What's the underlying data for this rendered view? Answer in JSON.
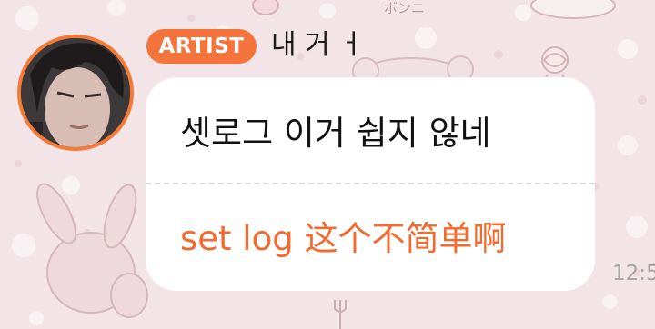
{
  "sender": {
    "badge_label": "ARTIST",
    "name": "내 거 ㅓ"
  },
  "message": {
    "original": "셋로그 이거 쉽지 않네",
    "translation": "set log 这个不简单啊",
    "time": "12:5"
  },
  "background": {
    "sticker_text": "ボンニ"
  },
  "colors": {
    "accent": "#f4743b",
    "translation_text": "#f26a2e",
    "background": "#f3e4e7",
    "bubble": "#ffffff"
  }
}
